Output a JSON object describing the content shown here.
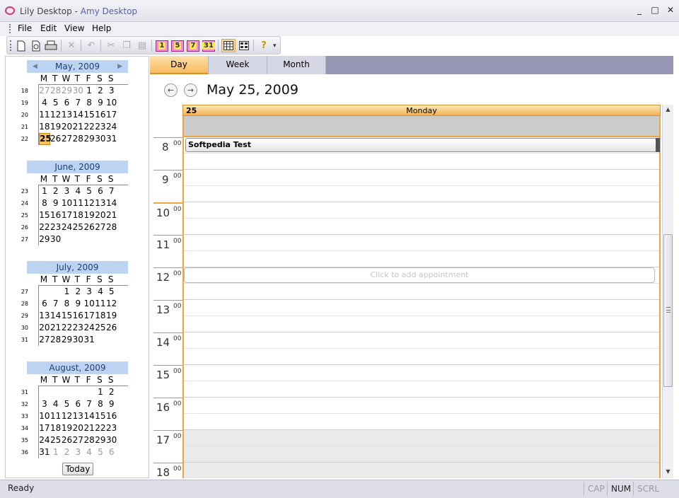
{
  "window": {
    "title": "Lily Desktop -",
    "subtitle": "Amy Desktop",
    "buttons": [
      "_",
      "□",
      "✕"
    ]
  },
  "menu": [
    "File",
    "Edit",
    "View",
    "Help"
  ],
  "toolbar": {
    "day_view_labels": [
      "1",
      "5",
      "7",
      "31"
    ]
  },
  "mini_calendars": [
    {
      "title": "May, 2009",
      "dow": [
        "M",
        "T",
        "W",
        "T",
        "F",
        "S",
        "S"
      ],
      "weeks": [
        {
          "num": "18",
          "days": [
            {
              "d": "27",
              "o": true
            },
            {
              "d": "28",
              "o": true
            },
            {
              "d": "29",
              "o": true
            },
            {
              "d": "30",
              "o": true
            },
            {
              "d": "1"
            },
            {
              "d": "2"
            },
            {
              "d": "3"
            }
          ]
        },
        {
          "num": "19",
          "days": [
            {
              "d": "4"
            },
            {
              "d": "5"
            },
            {
              "d": "6"
            },
            {
              "d": "7"
            },
            {
              "d": "8"
            },
            {
              "d": "9"
            },
            {
              "d": "10"
            }
          ]
        },
        {
          "num": "20",
          "days": [
            {
              "d": "11"
            },
            {
              "d": "12"
            },
            {
              "d": "13"
            },
            {
              "d": "14"
            },
            {
              "d": "15"
            },
            {
              "d": "16"
            },
            {
              "d": "17"
            }
          ]
        },
        {
          "num": "21",
          "days": [
            {
              "d": "18"
            },
            {
              "d": "19"
            },
            {
              "d": "20"
            },
            {
              "d": "21"
            },
            {
              "d": "22"
            },
            {
              "d": "23"
            },
            {
              "d": "24"
            }
          ]
        },
        {
          "num": "22",
          "days": [
            {
              "d": "25",
              "t": true
            },
            {
              "d": "26"
            },
            {
              "d": "27"
            },
            {
              "d": "28"
            },
            {
              "d": "29"
            },
            {
              "d": "30"
            },
            {
              "d": "31"
            }
          ]
        }
      ]
    },
    {
      "title": "June, 2009",
      "dow": [
        "M",
        "T",
        "W",
        "T",
        "F",
        "S",
        "S"
      ],
      "weeks": [
        {
          "num": "23",
          "days": [
            {
              "d": "1"
            },
            {
              "d": "2"
            },
            {
              "d": "3"
            },
            {
              "d": "4"
            },
            {
              "d": "5"
            },
            {
              "d": "6"
            },
            {
              "d": "7"
            }
          ]
        },
        {
          "num": "24",
          "days": [
            {
              "d": "8"
            },
            {
              "d": "9"
            },
            {
              "d": "10"
            },
            {
              "d": "11"
            },
            {
              "d": "12"
            },
            {
              "d": "13"
            },
            {
              "d": "14"
            }
          ]
        },
        {
          "num": "25",
          "days": [
            {
              "d": "15"
            },
            {
              "d": "16"
            },
            {
              "d": "17"
            },
            {
              "d": "18"
            },
            {
              "d": "19"
            },
            {
              "d": "20"
            },
            {
              "d": "21"
            }
          ]
        },
        {
          "num": "26",
          "days": [
            {
              "d": "22"
            },
            {
              "d": "23"
            },
            {
              "d": "24"
            },
            {
              "d": "25"
            },
            {
              "d": "26"
            },
            {
              "d": "27"
            },
            {
              "d": "28"
            }
          ]
        },
        {
          "num": "27",
          "days": [
            {
              "d": "29"
            },
            {
              "d": "30"
            },
            {
              "d": ""
            },
            {
              "d": ""
            },
            {
              "d": ""
            },
            {
              "d": ""
            },
            {
              "d": ""
            }
          ]
        }
      ]
    },
    {
      "title": "July, 2009",
      "dow": [
        "M",
        "T",
        "W",
        "T",
        "F",
        "S",
        "S"
      ],
      "weeks": [
        {
          "num": "27",
          "days": [
            {
              "d": ""
            },
            {
              "d": ""
            },
            {
              "d": "1"
            },
            {
              "d": "2"
            },
            {
              "d": "3"
            },
            {
              "d": "4"
            },
            {
              "d": "5"
            }
          ]
        },
        {
          "num": "28",
          "days": [
            {
              "d": "6"
            },
            {
              "d": "7"
            },
            {
              "d": "8"
            },
            {
              "d": "9"
            },
            {
              "d": "10"
            },
            {
              "d": "11"
            },
            {
              "d": "12"
            }
          ]
        },
        {
          "num": "29",
          "days": [
            {
              "d": "13"
            },
            {
              "d": "14"
            },
            {
              "d": "15"
            },
            {
              "d": "16"
            },
            {
              "d": "17"
            },
            {
              "d": "18"
            },
            {
              "d": "19"
            }
          ]
        },
        {
          "num": "30",
          "days": [
            {
              "d": "20"
            },
            {
              "d": "21"
            },
            {
              "d": "22"
            },
            {
              "d": "23"
            },
            {
              "d": "24"
            },
            {
              "d": "25"
            },
            {
              "d": "26"
            }
          ]
        },
        {
          "num": "31",
          "days": [
            {
              "d": "27"
            },
            {
              "d": "28"
            },
            {
              "d": "29"
            },
            {
              "d": "30"
            },
            {
              "d": "31"
            },
            {
              "d": ""
            },
            {
              "d": ""
            }
          ]
        }
      ]
    },
    {
      "title": "August, 2009",
      "dow": [
        "M",
        "T",
        "W",
        "T",
        "F",
        "S",
        "S"
      ],
      "weeks": [
        {
          "num": "31",
          "days": [
            {
              "d": ""
            },
            {
              "d": ""
            },
            {
              "d": ""
            },
            {
              "d": ""
            },
            {
              "d": ""
            },
            {
              "d": "1"
            },
            {
              "d": "2"
            }
          ]
        },
        {
          "num": "32",
          "days": [
            {
              "d": "3"
            },
            {
              "d": "4"
            },
            {
              "d": "5"
            },
            {
              "d": "6"
            },
            {
              "d": "7"
            },
            {
              "d": "8"
            },
            {
              "d": "9"
            }
          ]
        },
        {
          "num": "33",
          "days": [
            {
              "d": "10"
            },
            {
              "d": "11"
            },
            {
              "d": "12"
            },
            {
              "d": "13"
            },
            {
              "d": "14"
            },
            {
              "d": "15"
            },
            {
              "d": "16"
            }
          ]
        },
        {
          "num": "34",
          "days": [
            {
              "d": "17"
            },
            {
              "d": "18"
            },
            {
              "d": "19"
            },
            {
              "d": "20"
            },
            {
              "d": "21"
            },
            {
              "d": "22"
            },
            {
              "d": "23"
            }
          ]
        },
        {
          "num": "35",
          "days": [
            {
              "d": "24"
            },
            {
              "d": "25"
            },
            {
              "d": "26"
            },
            {
              "d": "27"
            },
            {
              "d": "28"
            },
            {
              "d": "29"
            },
            {
              "d": "30"
            }
          ]
        },
        {
          "num": "36",
          "days": [
            {
              "d": "31"
            },
            {
              "d": "1",
              "o": true
            },
            {
              "d": "2",
              "o": true
            },
            {
              "d": "3",
              "o": true
            },
            {
              "d": "4",
              "o": true
            },
            {
              "d": "5",
              "o": true
            },
            {
              "d": "6",
              "o": true
            }
          ]
        }
      ]
    }
  ],
  "today_button": "Today",
  "tabs": [
    "Day",
    "Week",
    "Month"
  ],
  "active_tab": "Day",
  "date_title": "May 25, 2009",
  "day_header": {
    "number": "25",
    "name": "Monday"
  },
  "hours": [
    {
      "h": "8",
      "m": "00"
    },
    {
      "h": "9",
      "m": "00"
    },
    {
      "h": "10",
      "m": "00"
    },
    {
      "h": "11",
      "m": "00"
    },
    {
      "h": "12",
      "m": "00"
    },
    {
      "h": "13",
      "m": "00"
    },
    {
      "h": "14",
      "m": "00"
    },
    {
      "h": "15",
      "m": "00"
    },
    {
      "h": "16",
      "m": "00"
    },
    {
      "h": "17",
      "m": "00"
    },
    {
      "h": "18",
      "m": "00"
    }
  ],
  "appointment": {
    "title": "Softpedia Test"
  },
  "add_appointment_prompt": "Click to add appointment",
  "status": {
    "text": "Ready",
    "indicators": [
      {
        "label": "CAP",
        "on": false
      },
      {
        "label": "NUM",
        "on": true
      },
      {
        "label": "SCRL",
        "on": false
      }
    ]
  },
  "colors": {
    "accent_orange": "#f0a33e",
    "tab_bar": "#9597b4",
    "mini_cal_header": "#bcd3f2"
  }
}
